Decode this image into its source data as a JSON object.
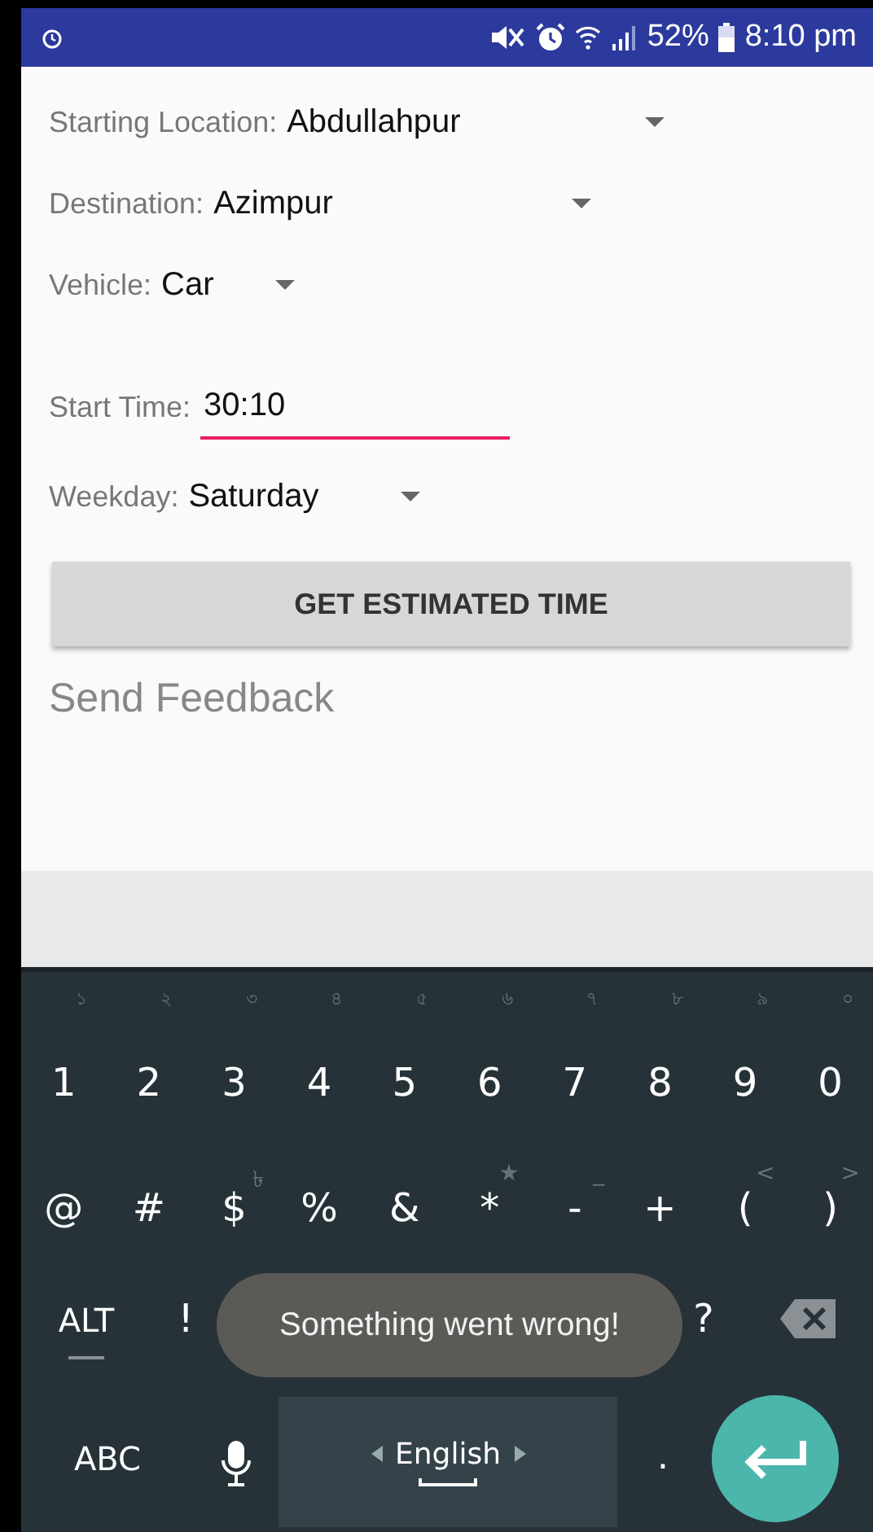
{
  "status_bar": {
    "battery": "52%",
    "time": "8:10 pm"
  },
  "form": [
    {
      "kind": "dropdown",
      "label": "Starting Location:",
      "value": "Abdullahpur"
    },
    {
      "kind": "dropdown",
      "label": "Destination:",
      "value": "Azimpur"
    },
    {
      "kind": "dropdown",
      "label": "Vehicle:",
      "value": "Car"
    },
    {
      "kind": "text",
      "label": "Start Time:",
      "value": "30:10",
      "focused": true
    },
    {
      "kind": "dropdown",
      "label": "Weekday:",
      "value": "Saturday"
    }
  ],
  "button": "GET ESTIMATED TIME",
  "link": "Send Feedback",
  "keyboard": {
    "number_row": [
      {
        "key": "1",
        "hint": "১"
      },
      {
        "key": "2",
        "hint": "২"
      },
      {
        "key": "3",
        "hint": "৩"
      },
      {
        "key": "4",
        "hint": "৪"
      },
      {
        "key": "5",
        "hint": "৫"
      },
      {
        "key": "6",
        "hint": "৬"
      },
      {
        "key": "7",
        "hint": "৭"
      },
      {
        "key": "8",
        "hint": "৮"
      },
      {
        "key": "9",
        "hint": "৯"
      },
      {
        "key": "0",
        "hint": "০"
      }
    ],
    "symbol_row": [
      {
        "key": "@"
      },
      {
        "key": "#"
      },
      {
        "key": "$",
        "hint": "৳"
      },
      {
        "key": "%"
      },
      {
        "key": "&"
      },
      {
        "key": "*",
        "hint": "★"
      },
      {
        "key": "-",
        "hint": "_"
      },
      {
        "key": "+"
      },
      {
        "key": "(",
        "hint": "<"
      },
      {
        "key": ")",
        "hint": ">"
      }
    ],
    "alt": "ALT",
    "exclaim": "!",
    "question": "?",
    "abc": "ABC",
    "space": "English",
    "period": "."
  },
  "toast": "Something went wrong!"
}
